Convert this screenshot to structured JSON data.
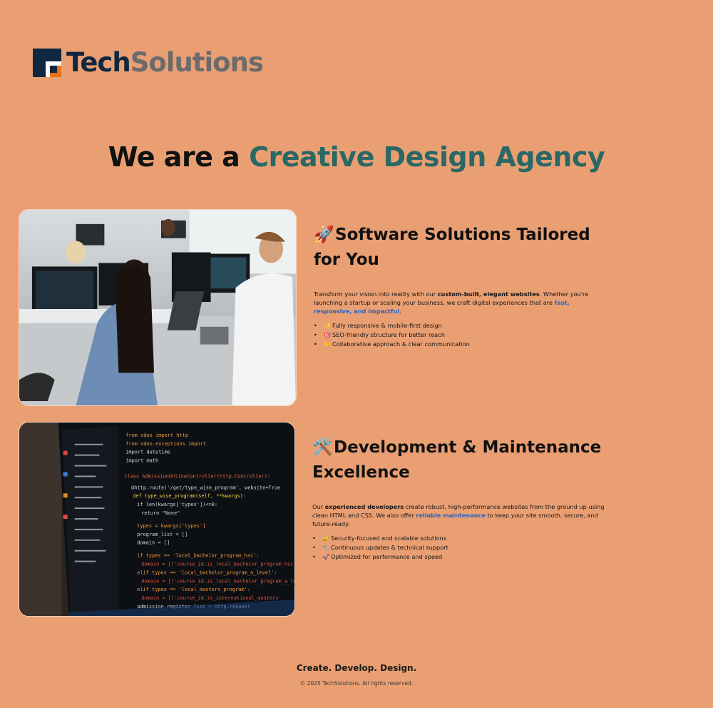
{
  "brand": {
    "name_part1": "Tech",
    "name_part2": "Solutions",
    "icon": "techsolutions-logo-icon"
  },
  "hero": {
    "prefix": "We are a ",
    "accent": "Creative Design Agency",
    "accent_color": "#2a6865"
  },
  "section1": {
    "emoji": "🚀",
    "title": "Software Solutions Tailored for You",
    "body_a": "Transform your vision into reality with our ",
    "body_bold": "custom-built, elegant websites",
    "body_b": ". Whether you're launching a startup or scaling your business, we craft digital experiences that are ",
    "body_link": "fast, responsive, and impactful",
    "body_c": ".",
    "bullets": [
      {
        "icon": "✨",
        "text": "Fully responsive & mobile-first design"
      },
      {
        "icon": "🎯",
        "text": "SEO-friendly structure for better reach"
      },
      {
        "icon": "🤝",
        "text": "Collaborative approach & clear communication"
      }
    ],
    "image": "office-developers-photo"
  },
  "section2": {
    "emoji": "🛠️",
    "title": "Development & Maintenance Excellence",
    "body_a": "Our ",
    "body_bold": "experienced developers",
    "body_b": " create robust, high-performance websites from the ground up using clean HTML and CSS. We also offer ",
    "body_link": "reliable maintenance",
    "body_c": " to keep your site smooth, secure, and future-ready.",
    "bullets": [
      {
        "icon": "🔐",
        "text": "Security-focused and scalable solutions"
      },
      {
        "icon": "🔧",
        "text": "Continuous updates & technical support"
      },
      {
        "icon": "🚀",
        "text": "Optimized for performance and speed"
      }
    ],
    "image": "code-screen-photo"
  },
  "footer": {
    "tagline": "Create. Develop. Design.",
    "copyright": "© 2025 TechSolutions. All rights reserved."
  },
  "colors": {
    "background": "#ea9f73",
    "brand_dark": "#0f2740",
    "brand_gray": "#6b6b6b",
    "link": "#1e62c9"
  }
}
